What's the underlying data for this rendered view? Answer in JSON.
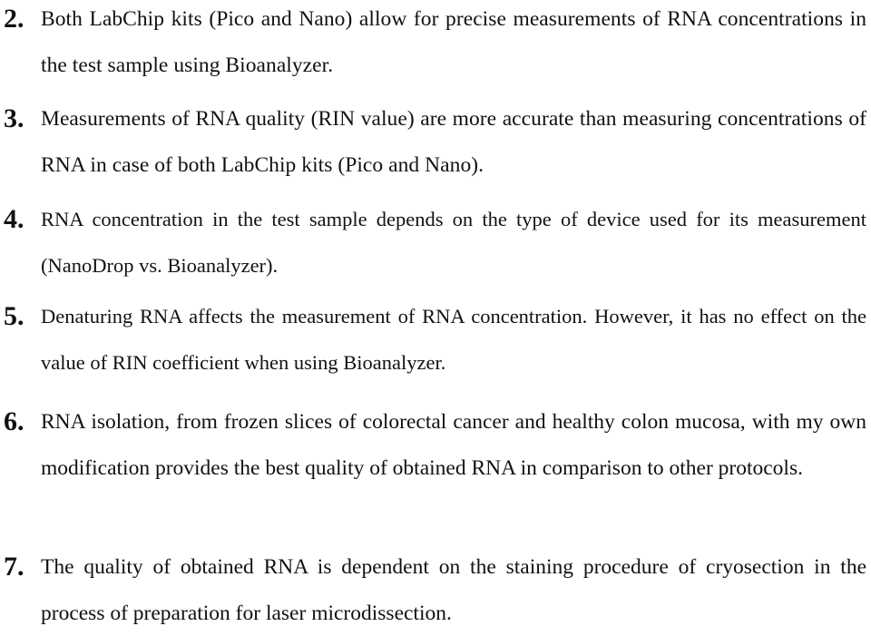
{
  "document": {
    "items": [
      {
        "number": "2.",
        "text": "Both LabChip kits (Pico and Nano) allow for precise measurements of RNA concentrations in the test sample using Bioanalyzer."
      },
      {
        "number": "3.",
        "text": "Measurements of RNA quality (RIN value) are more accurate than measuring concentrations of RNA in case of both LabChip kits (Pico and Nano)."
      },
      {
        "number": "4.",
        "text": "RNA concentration in the test sample depends on the type of device used for its measurement (NanoDrop vs. Bioanalyzer)."
      },
      {
        "number": "5.",
        "text": "Denaturing RNA affects the measurement of RNA concentration. However, it has no effect on the value of RIN coefficient when using Bioanalyzer."
      },
      {
        "number": "6.",
        "text": "RNA isolation, from frozen slices of colorectal cancer and healthy colon mucosa, with my own modification provides the best quality of obtained RNA in comparison to other protocols."
      },
      {
        "number": "7.",
        "text": "The quality of obtained RNA is dependent on the staining procedure of cryosection in the process of preparation for laser microdissection."
      }
    ]
  }
}
